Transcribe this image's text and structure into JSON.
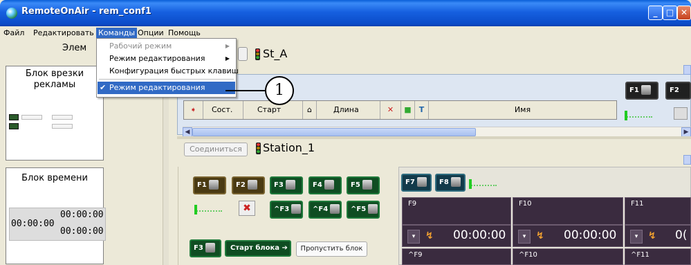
{
  "window": {
    "title": "RemoteOnAir - rem_conf1"
  },
  "menubar": {
    "items": [
      "Файл",
      "Редактировать",
      "Команды",
      "Опции",
      "Помощь"
    ]
  },
  "dropdown": {
    "items": [
      {
        "label": "Рабочий режим",
        "state": "disabled"
      },
      {
        "label": "Режим редактирования",
        "state": "submenu"
      },
      {
        "label": "Конфигурация быстрых клавиш",
        "state": "normal"
      },
      {
        "label": "Режим редактирования",
        "state": "checked"
      }
    ]
  },
  "callout": {
    "number": "1"
  },
  "left_panel": {
    "header": "Элем",
    "ad_block": {
      "title_line1": "Блок врезки",
      "title_line2": "рекламы"
    },
    "time_block": {
      "title": "Блок времени",
      "time_left": "00:00:00",
      "time_right_top": "00:00:00",
      "time_right_bottom": "00:00:00"
    }
  },
  "station_a": {
    "label": "St_A",
    "columns": [
      "Сост.",
      "Старт",
      "Длина",
      "Имя"
    ],
    "fkeys": [
      "F1",
      "F2"
    ]
  },
  "station_1": {
    "connect_button": "Соединиться",
    "label": "Station_1",
    "fkeys_row1": [
      "F1",
      "F2",
      "F3",
      "F4",
      "F5"
    ],
    "fkeys_row2": [
      "^F3",
      "^F4",
      "^F5"
    ],
    "fkey_f3": "F3",
    "start_block": "Старт блока",
    "skip_block": "Пропустить блок",
    "right_fkeys": [
      "F7",
      "F8"
    ],
    "cells": [
      "F9",
      "F10",
      "F11"
    ],
    "cells_bottom": [
      "^F9",
      "^F10",
      "^F11"
    ],
    "times": [
      "00:00:00",
      "00:00:00",
      "0("
    ]
  }
}
